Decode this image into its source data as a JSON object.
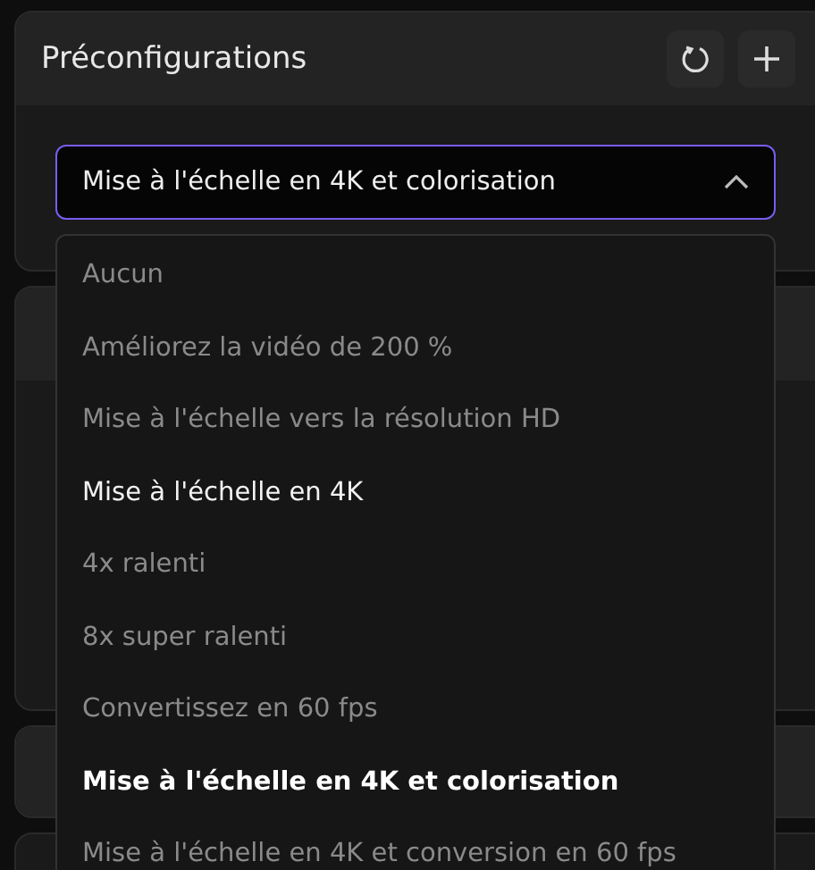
{
  "presets_panel": {
    "title": "Préconfigurations",
    "dropdown": {
      "value": "Mise à l'échelle en 4K et colorisation",
      "expanded": true
    }
  },
  "menu_items": [
    {
      "label": "Aucun",
      "selected": false,
      "hovered": false
    },
    {
      "label": "Améliorez la vidéo de 200 %",
      "selected": false,
      "hovered": false
    },
    {
      "label": "Mise à l'échelle vers la résolution HD",
      "selected": false,
      "hovered": false
    },
    {
      "label": "Mise à l'échelle en 4K",
      "selected": false,
      "hovered": true
    },
    {
      "label": "4x ralenti",
      "selected": false,
      "hovered": false
    },
    {
      "label": "8x super ralenti",
      "selected": false,
      "hovered": false
    },
    {
      "label": "Convertissez en 60 fps",
      "selected": false,
      "hovered": false
    },
    {
      "label": "Mise à l'échelle en 4K et colorisation",
      "selected": true,
      "hovered": false
    },
    {
      "label": "Mise à l'échelle en 4K et conversion en 60 fps",
      "selected": false,
      "hovered": false
    }
  ]
}
